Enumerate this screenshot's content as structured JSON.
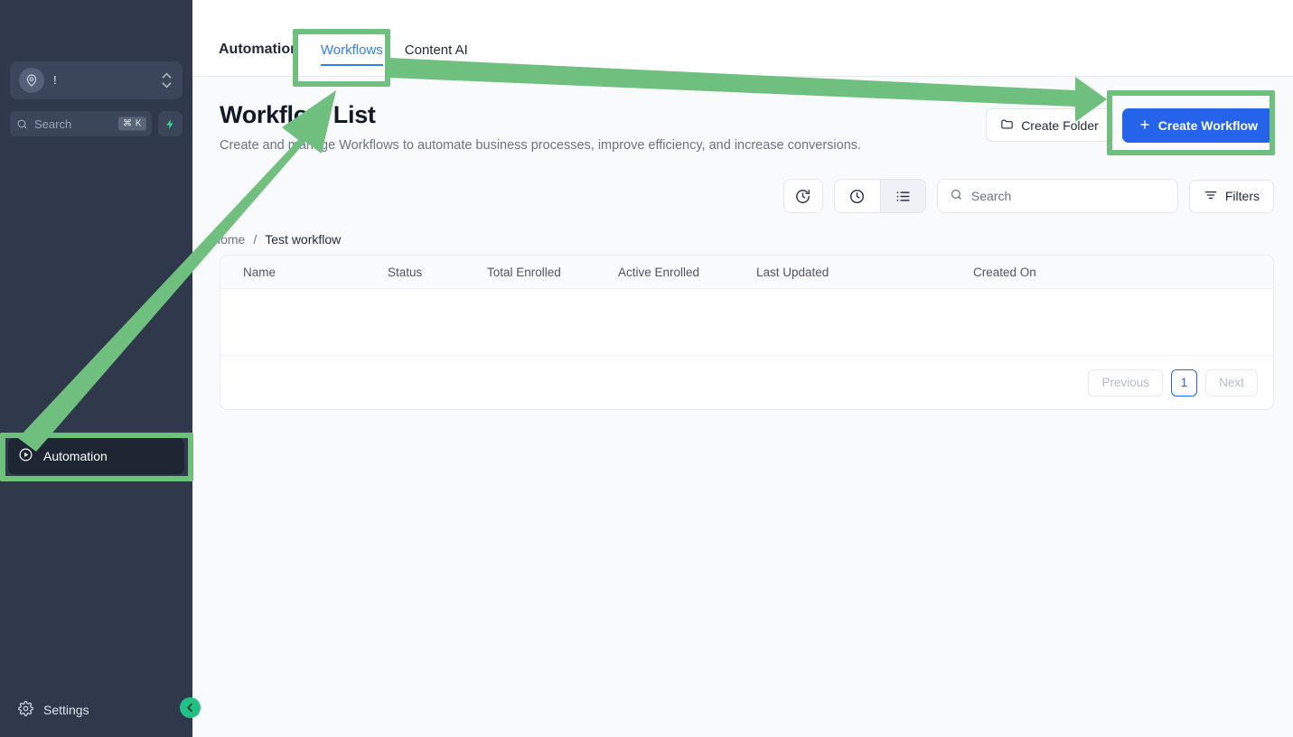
{
  "sidebar": {
    "location_switcher": {
      "name": "location-pin-icon",
      "label": "!"
    },
    "search": {
      "placeholder": "Search",
      "shortcut": "⌘ K",
      "icon": "search-icon"
    },
    "bolt_icon": "lightning-bolt-icon",
    "items": [
      {
        "label": "Automation",
        "icon": "automation-play-icon",
        "active": true
      },
      {
        "label": "Settings",
        "icon": "gear-icon",
        "active": false
      }
    ],
    "collapse_icon": "chevron-left-icon"
  },
  "tabs": [
    {
      "label": "Automation",
      "active": false,
      "bold": true
    },
    {
      "label": "Workflows",
      "active": true,
      "bold": false
    },
    {
      "label": "Content AI",
      "active": false,
      "bold": false
    }
  ],
  "page": {
    "title": "Workflow List",
    "subtitle": "Create and manage Workflows to automate business processes, improve efficiency, and increase conversions."
  },
  "head_actions": {
    "create_folder": {
      "label": "Create Folder",
      "icon": "folder-icon"
    },
    "create_workflow": {
      "label": "Create Workflow",
      "icon": "plus-icon"
    }
  },
  "toolbar": {
    "history_icon": "clock-refresh-icon",
    "recent_icon": "clock-icon",
    "list_icon": "list-view-icon",
    "search": {
      "placeholder": "Search",
      "icon": "search-icon"
    },
    "filters": {
      "label": "Filters",
      "icon": "filter-icon"
    }
  },
  "breadcrumb": {
    "home": "Home",
    "separator": "/",
    "current": "Test workflow"
  },
  "table": {
    "columns": [
      "Name",
      "Status",
      "Total Enrolled",
      "Active Enrolled",
      "Last Updated",
      "Created On"
    ],
    "rows": []
  },
  "pagination": {
    "previous": "Previous",
    "page": "1",
    "next": "Next"
  },
  "colors": {
    "accent_blue": "#2563eb",
    "tab_active_blue": "#2f80ed",
    "annotation_green": "#6fbf7f",
    "sidebar_bg": "#2f394b",
    "content_bg": "#f9fafb",
    "collapse_green": "#22c087"
  }
}
